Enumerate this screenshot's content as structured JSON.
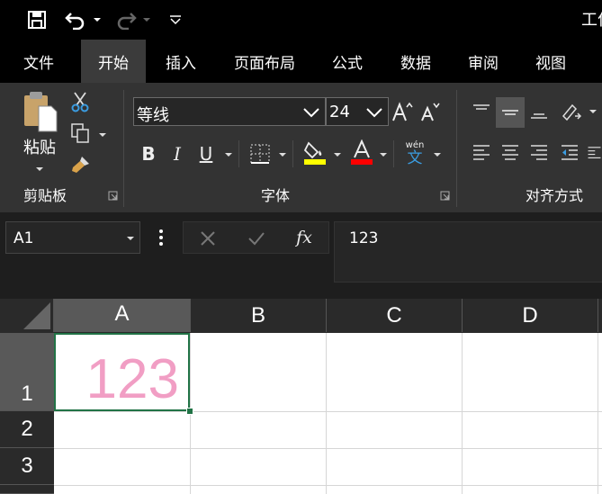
{
  "title": "工作",
  "tabs": [
    {
      "label": "文件"
    },
    {
      "label": "开始",
      "active": true
    },
    {
      "label": "插入"
    },
    {
      "label": "页面布局"
    },
    {
      "label": "公式"
    },
    {
      "label": "数据"
    },
    {
      "label": "审阅"
    },
    {
      "label": "视图"
    }
  ],
  "ribbon": {
    "clipboard": {
      "label": "剪贴板",
      "paste_label": "粘贴"
    },
    "font": {
      "label": "字体",
      "font_name": "等线",
      "font_size": "24",
      "bold": "B",
      "italic": "I",
      "underline": "U",
      "phonetic_top": "wén",
      "phonetic_bottom": "文",
      "highlight_color": "#ffff00",
      "font_color": "#ff0000"
    },
    "alignment": {
      "label": "对齐方式"
    }
  },
  "formula_bar": {
    "name_box": "A1",
    "fx": "fx",
    "value": "123"
  },
  "grid": {
    "columns": [
      "A",
      "B",
      "C",
      "D"
    ],
    "rows": [
      "1",
      "2",
      "3"
    ],
    "selected_cell": "A1",
    "cell_A1": "123",
    "cell_text_color": "#f19ec4",
    "accent_color": "#217346"
  }
}
